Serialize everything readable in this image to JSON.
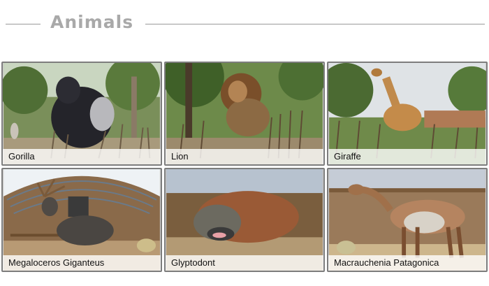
{
  "section": {
    "title": "Animals"
  },
  "cards": [
    {
      "label": "Gorilla"
    },
    {
      "label": "Lion"
    },
    {
      "label": "Giraffe"
    },
    {
      "label": "Megaloceros Giganteus"
    },
    {
      "label": "Glyptodont"
    },
    {
      "label": "Macrauchenia Patagonica"
    }
  ]
}
